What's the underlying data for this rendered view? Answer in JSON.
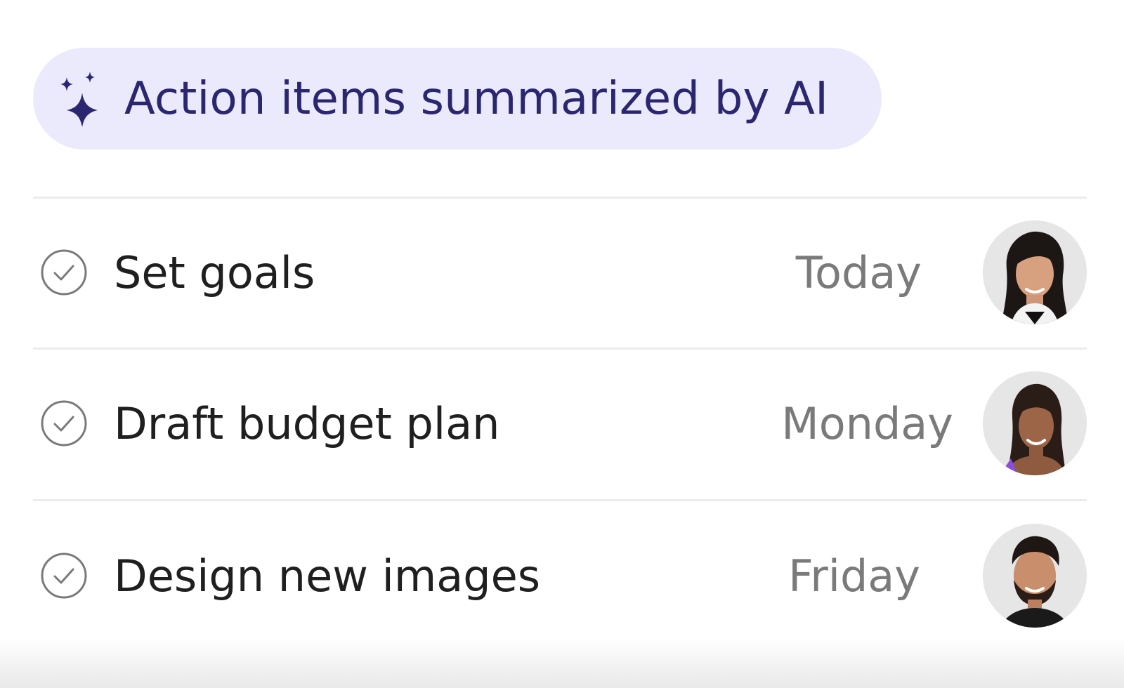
{
  "header": {
    "icon": "sparkle-icon",
    "label": "Action items summarized by AI",
    "accent_color": "#2b2670",
    "background_color": "#ebeafc"
  },
  "tasks": [
    {
      "title": "Set goals",
      "due": "Today",
      "icon": "check-circle-icon",
      "avatar": "avatar-woman-long-dark-hair"
    },
    {
      "title": "Draft budget plan",
      "due": "Monday",
      "icon": "check-circle-icon",
      "avatar": "avatar-woman-purple-top"
    },
    {
      "title": "Design new images",
      "due": "Friday",
      "icon": "check-circle-icon",
      "avatar": "avatar-man-beard"
    }
  ]
}
